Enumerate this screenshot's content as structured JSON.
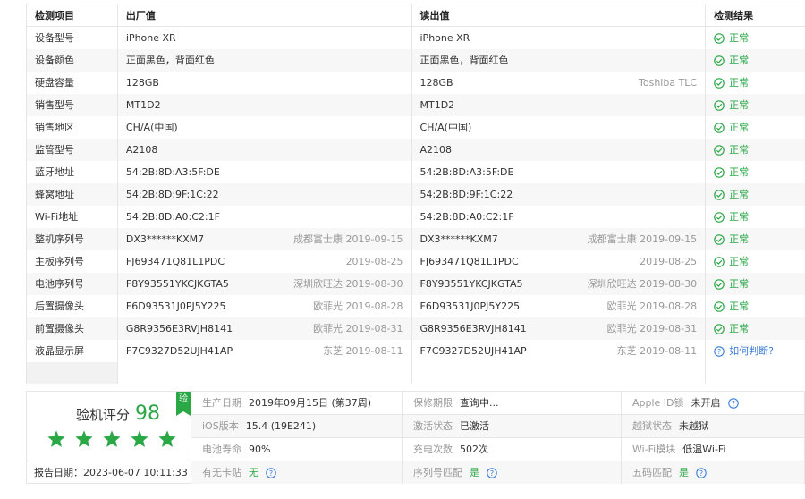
{
  "header": {
    "item": "检测项目",
    "factory": "出厂值",
    "read": "读出值",
    "result": "检测结果"
  },
  "rows": [
    {
      "label": "设备型号",
      "factory": "iPhone XR",
      "factory_note": "",
      "read": "iPhone XR",
      "read_note": "",
      "result": "正常",
      "status": "ok"
    },
    {
      "label": "设备颜色",
      "factory": "正面黑色，背面红色",
      "factory_note": "",
      "read": "正面黑色，背面红色",
      "read_note": "",
      "result": "正常",
      "status": "ok"
    },
    {
      "label": "硬盘容量",
      "factory": "128GB",
      "factory_note": "",
      "read": "128GB",
      "read_note": "Toshiba TLC",
      "result": "正常",
      "status": "ok"
    },
    {
      "label": "销售型号",
      "factory": "MT1D2",
      "factory_note": "",
      "read": "MT1D2",
      "read_note": "",
      "result": "正常",
      "status": "ok"
    },
    {
      "label": "销售地区",
      "factory": "CH/A(中国)",
      "factory_note": "",
      "read": "CH/A(中国)",
      "read_note": "",
      "result": "正常",
      "status": "ok"
    },
    {
      "label": "监管型号",
      "factory": "A2108",
      "factory_note": "",
      "read": "A2108",
      "read_note": "",
      "result": "正常",
      "status": "ok"
    },
    {
      "label": "蓝牙地址",
      "factory": "54:2B:8D:A3:5F:DE",
      "factory_note": "",
      "read": "54:2B:8D:A3:5F:DE",
      "read_note": "",
      "result": "正常",
      "status": "ok"
    },
    {
      "label": "蜂窝地址",
      "factory": "54:2B:8D:9F:1C:22",
      "factory_note": "",
      "read": "54:2B:8D:9F:1C:22",
      "read_note": "",
      "result": "正常",
      "status": "ok"
    },
    {
      "label": "Wi-Fi地址",
      "factory": "54:2B:8D:A0:C2:1F",
      "factory_note": "",
      "read": "54:2B:8D:A0:C2:1F",
      "read_note": "",
      "result": "正常",
      "status": "ok"
    },
    {
      "label": "整机序列号",
      "factory": "DX3******KXM7",
      "factory_note": "成都富士康 2019-09-15",
      "read": "DX3******KXM7",
      "read_note": "成都富士康 2019-09-15",
      "result": "正常",
      "status": "ok"
    },
    {
      "label": "主板序列号",
      "factory": "FJ693471Q81L1PDC",
      "factory_note": "2019-08-25",
      "read": "FJ693471Q81L1PDC",
      "read_note": "2019-08-25",
      "result": "正常",
      "status": "ok"
    },
    {
      "label": "电池序列号",
      "factory": "F8Y93551YKCJKGTA5",
      "factory_note": "深圳欣旺达 2019-08-30",
      "read": "F8Y93551YKCJKGTA5",
      "read_note": "深圳欣旺达 2019-08-30",
      "result": "正常",
      "status": "ok"
    },
    {
      "label": "后置摄像头",
      "factory": "F6D93531J0PJ5Y225",
      "factory_note": "欧菲光 2019-08-28",
      "read": "F6D93531J0PJ5Y225",
      "read_note": "欧菲光 2019-08-28",
      "result": "正常",
      "status": "ok"
    },
    {
      "label": "前置摄像头",
      "factory": "G8R9356E3RVJH8141",
      "factory_note": "欧菲光 2019-08-31",
      "read": "G8R9356E3RVJH8141",
      "read_note": "欧菲光 2019-08-31",
      "result": "正常",
      "status": "ok"
    },
    {
      "label": "液晶显示屏",
      "factory": "F7C9327D52UJH41AP",
      "factory_note": "东芝 2019-08-11",
      "read": "F7C9327D52UJH41AP",
      "read_note": "东芝 2019-08-11",
      "result": "如何判断?",
      "status": "question"
    }
  ],
  "summary": {
    "score_label": "验机评分",
    "score": "98",
    "badge": "验",
    "stars": 5,
    "report_date": "报告日期：2023-06-07 10:11:33",
    "cells": [
      {
        "label": "生产日期",
        "value": "2019年09月15日 (第37周)",
        "green": false,
        "help": false
      },
      {
        "label": "保修期限",
        "value": "查询中...",
        "green": false,
        "help": false
      },
      {
        "label": "Apple ID锁",
        "value": "未开启",
        "green": false,
        "help": true
      },
      {
        "label": "iOS版本",
        "value": "15.4 (19E241)",
        "green": false,
        "help": false
      },
      {
        "label": "激活状态",
        "value": "已激活",
        "green": false,
        "help": false
      },
      {
        "label": "越狱状态",
        "value": "未越狱",
        "green": false,
        "help": false
      },
      {
        "label": "电池寿命",
        "value": "90%",
        "green": false,
        "help": false
      },
      {
        "label": "充电次数",
        "value": "502次",
        "green": false,
        "help": false
      },
      {
        "label": "Wi-Fi模块",
        "value": "低温Wi-Fi",
        "green": false,
        "help": false
      },
      {
        "label": "有无卡贴",
        "value": "无",
        "green": true,
        "help": true
      },
      {
        "label": "序列号匹配",
        "value": "是",
        "green": true,
        "help": true
      },
      {
        "label": "五码匹配",
        "value": "是",
        "green": true,
        "help": true
      }
    ]
  },
  "colors": {
    "ok": "#2aa846",
    "question": "#3b7dd8",
    "note": "#999999"
  }
}
